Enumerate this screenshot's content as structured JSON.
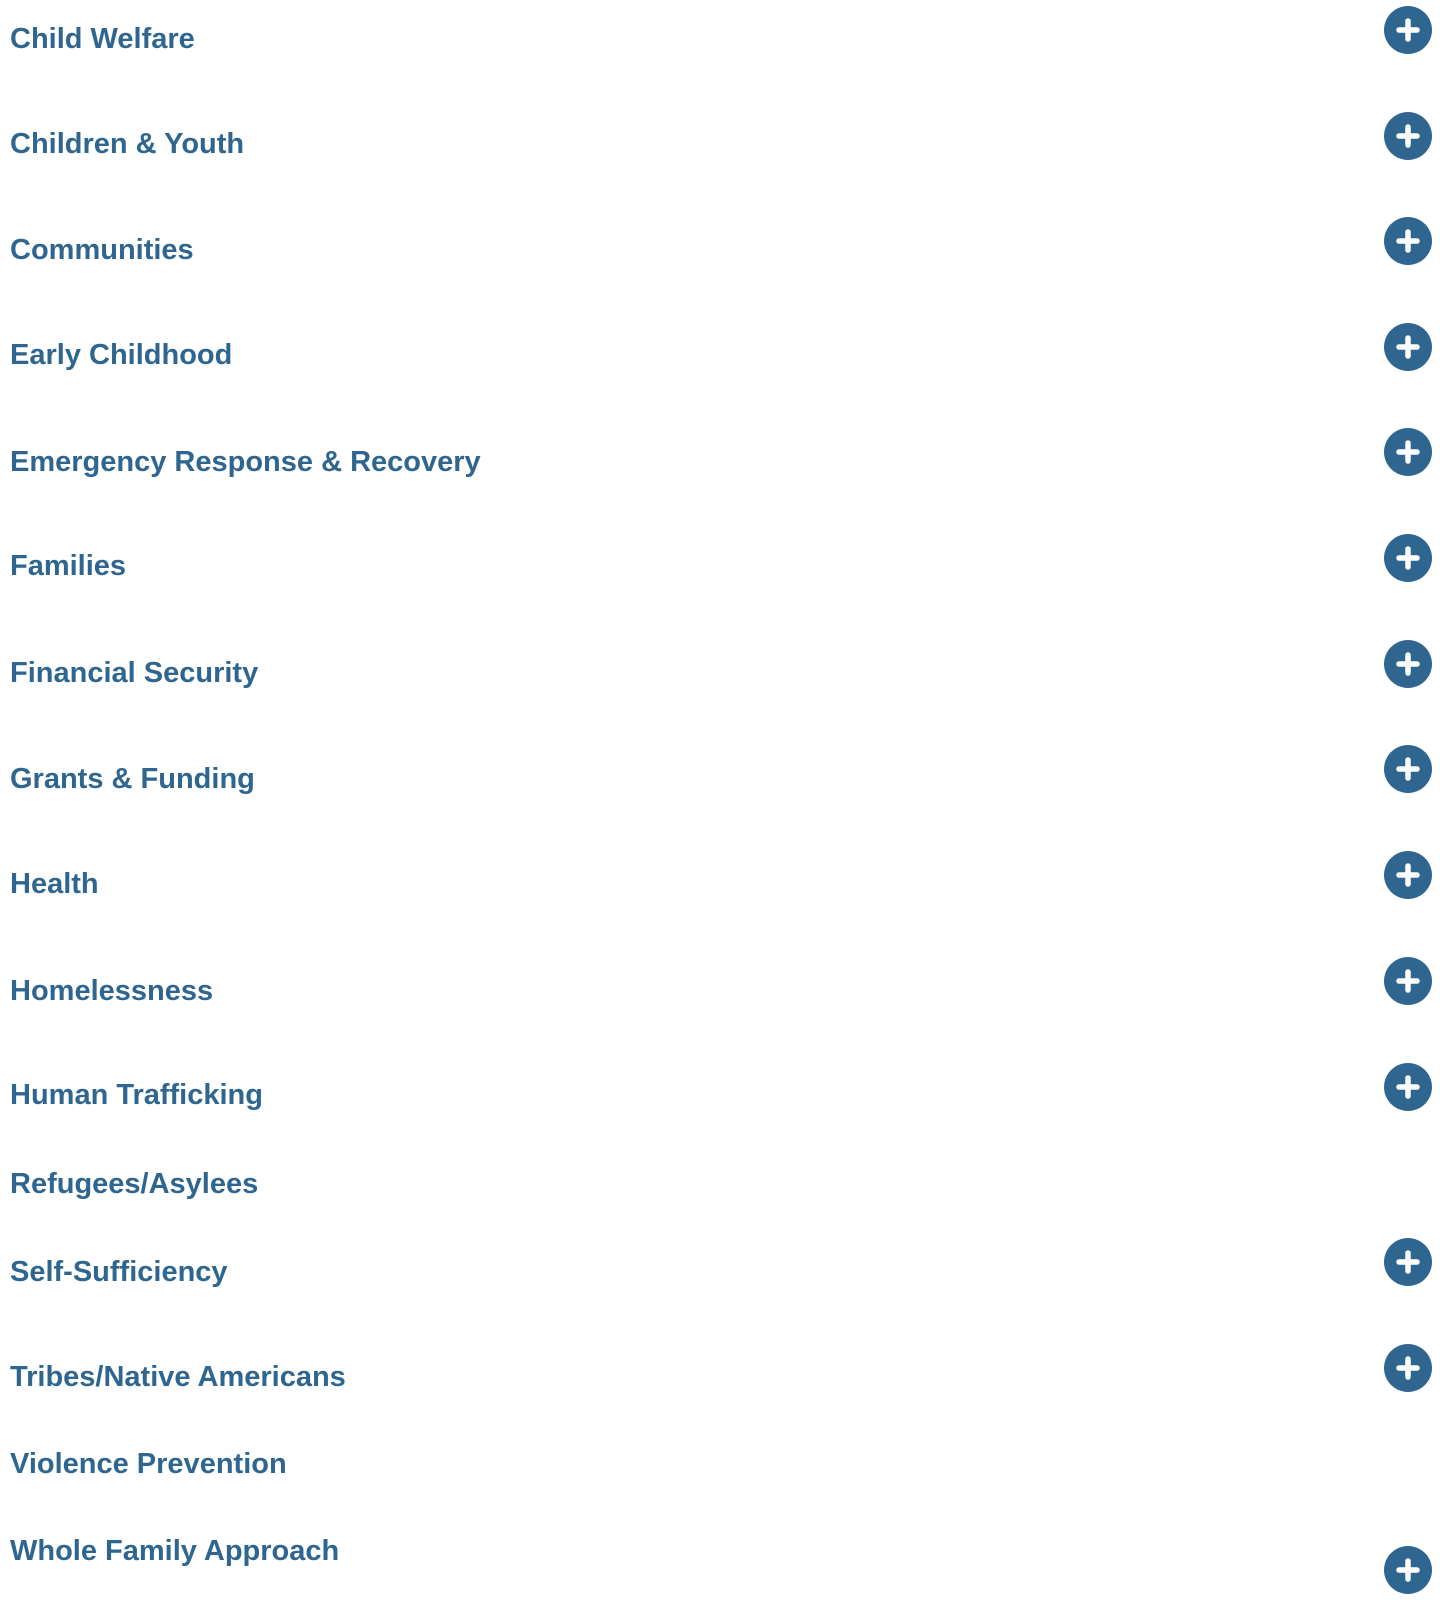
{
  "colors": {
    "accent": "#2f6690",
    "background": "#ffffff",
    "icon_glyph": "#ffffff"
  },
  "topics": [
    {
      "label": "Child Welfare",
      "expandable": true,
      "icon": "plus-circle-icon"
    },
    {
      "label": "Children & Youth",
      "expandable": true,
      "icon": "plus-circle-icon"
    },
    {
      "label": "Communities",
      "expandable": true,
      "icon": "plus-circle-icon"
    },
    {
      "label": "Early Childhood",
      "expandable": true,
      "icon": "plus-circle-icon"
    },
    {
      "label": "Emergency Response & Recovery",
      "expandable": true,
      "icon": "plus-circle-icon"
    },
    {
      "label": "Families",
      "expandable": true,
      "icon": "plus-circle-icon"
    },
    {
      "label": "Financial Security",
      "expandable": true,
      "icon": "plus-circle-icon"
    },
    {
      "label": "Grants & Funding",
      "expandable": true,
      "icon": "plus-circle-icon"
    },
    {
      "label": "Health",
      "expandable": true,
      "icon": "plus-circle-icon"
    },
    {
      "label": "Homelessness",
      "expandable": true,
      "icon": "plus-circle-icon"
    },
    {
      "label": "Human Trafficking",
      "expandable": true,
      "icon": "plus-circle-icon"
    },
    {
      "label": "Refugees/Asylees",
      "expandable": false
    },
    {
      "label": "Self-Sufficiency",
      "expandable": true,
      "icon": "plus-circle-icon"
    },
    {
      "label": "Tribes/Native Americans",
      "expandable": true,
      "icon": "plus-circle-icon"
    },
    {
      "label": "Violence Prevention",
      "expandable": false
    },
    {
      "label": "Whole Family Approach",
      "expandable": true,
      "icon": "plus-circle-icon"
    }
  ]
}
